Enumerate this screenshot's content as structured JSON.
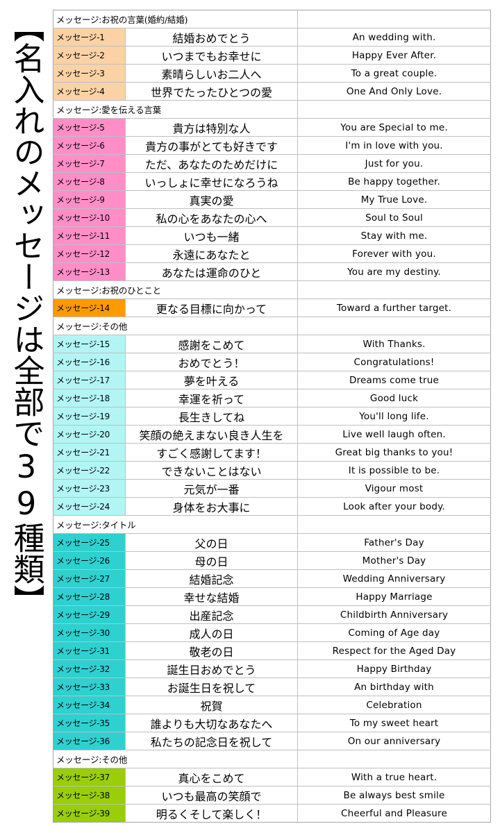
{
  "caption": {
    "vertical_text": "【名入れのメッセージは全部で39種類】"
  },
  "colors": {
    "group_peach": "#fbd2a6",
    "group_pink": "#ff8ec7",
    "group_orange": "#ff9900",
    "group_cyan": "#b3f5f5",
    "group_teal": "#2fd0d0",
    "group_olive": "#9acd0a",
    "table_border": "#a6a6a6",
    "grid_line": "#bfbfbf",
    "page_background": "#ffffff",
    "text": "#000000"
  },
  "table": {
    "columns": [
      "message_id",
      "japanese",
      "english"
    ],
    "rows": [
      {
        "kind": "group",
        "label": "メッセージ:お祝の言葉(婚約/結婚)",
        "color": null
      },
      {
        "kind": "item",
        "id": "メッセージ-1",
        "jp": "結婚おめでとう",
        "en": "An wedding with.",
        "color": "group_peach"
      },
      {
        "kind": "item",
        "id": "メッセージ-2",
        "jp": "いつまでもお幸せに",
        "en": "Happy Ever After.",
        "color": "group_peach"
      },
      {
        "kind": "item",
        "id": "メッセージ-3",
        "jp": "素晴らしいお二人へ",
        "en": "To a great couple.",
        "color": "group_peach"
      },
      {
        "kind": "item",
        "id": "メッセージ-4",
        "jp": "世界でたったひとつの愛",
        "en": "One And Only Love.",
        "color": "group_peach"
      },
      {
        "kind": "group",
        "label": "メッセージ:愛を伝える言葉",
        "color": null
      },
      {
        "kind": "item",
        "id": "メッセージ-5",
        "jp": "貴方は特別な人",
        "en": "You are Special to me.",
        "color": "group_pink"
      },
      {
        "kind": "item",
        "id": "メッセージ-6",
        "jp": "貴方の事がとても好きです",
        "en": "I'm in love with you.",
        "color": "group_pink"
      },
      {
        "kind": "item",
        "id": "メッセージ-7",
        "jp": "ただ、あなたのためだけに",
        "en": "Just for you.",
        "color": "group_pink"
      },
      {
        "kind": "item",
        "id": "メッセージ-8",
        "jp": "いっしょに幸せになろうね",
        "en": "Be happy together.",
        "color": "group_pink"
      },
      {
        "kind": "item",
        "id": "メッセージ-9",
        "jp": "真実の愛",
        "en": "My True Love.",
        "color": "group_pink"
      },
      {
        "kind": "item",
        "id": "メッセージ-10",
        "jp": "私の心をあなたの心へ",
        "en": "Soul to Soul",
        "color": "group_pink"
      },
      {
        "kind": "item",
        "id": "メッセージ-11",
        "jp": "いつも一緒",
        "en": "Stay with me.",
        "color": "group_pink"
      },
      {
        "kind": "item",
        "id": "メッセージ-12",
        "jp": "永遠にあなたと",
        "en": "Forever with you.",
        "color": "group_pink"
      },
      {
        "kind": "item",
        "id": "メッセージ-13",
        "jp": "あなたは運命のひと",
        "en": "You are my destiny.",
        "color": "group_pink"
      },
      {
        "kind": "group",
        "label": "メッセージ:お祝のひとこと",
        "color": null
      },
      {
        "kind": "item",
        "id": "メッセージ-14",
        "jp": "更なる目標に向かって",
        "en": "Toward a further target.",
        "color": "group_orange"
      },
      {
        "kind": "group",
        "label": "メッセージ:その他",
        "color": null
      },
      {
        "kind": "item",
        "id": "メッセージ-15",
        "jp": "感謝をこめて",
        "en": "With Thanks.",
        "color": "group_cyan"
      },
      {
        "kind": "item",
        "id": "メッセージ-16",
        "jp": "おめでとう！",
        "en": "Congratulations!",
        "color": "group_cyan"
      },
      {
        "kind": "item",
        "id": "メッセージ-17",
        "jp": "夢を叶える",
        "en": "Dreams come true",
        "color": "group_cyan"
      },
      {
        "kind": "item",
        "id": "メッセージ-18",
        "jp": "幸運を祈って",
        "en": "Good luck",
        "color": "group_cyan"
      },
      {
        "kind": "item",
        "id": "メッセージ-19",
        "jp": "長生きしてね",
        "en": "You'll long life.",
        "color": "group_cyan"
      },
      {
        "kind": "item",
        "id": "メッセージ-20",
        "jp": "笑顔の絶えまない良き人生を",
        "en": "Live well laugh often.",
        "color": "group_cyan"
      },
      {
        "kind": "item",
        "id": "メッセージ-21",
        "jp": "すごく感謝してます！",
        "en": "Great big thanks to you!",
        "color": "group_cyan"
      },
      {
        "kind": "item",
        "id": "メッセージ-22",
        "jp": "できないことはない",
        "en": "It is possible to be.",
        "color": "group_cyan"
      },
      {
        "kind": "item",
        "id": "メッセージ-23",
        "jp": "元気が一番",
        "en": "Vigour most",
        "color": "group_cyan"
      },
      {
        "kind": "item",
        "id": "メッセージ-24",
        "jp": "身体をお大事に",
        "en": "Look after your body.",
        "color": "group_cyan"
      },
      {
        "kind": "group",
        "label": "メッセージ:タイトル",
        "color": null
      },
      {
        "kind": "item",
        "id": "メッセージ-25",
        "jp": "父の日",
        "en": "Father's Day",
        "color": "group_teal"
      },
      {
        "kind": "item",
        "id": "メッセージ-26",
        "jp": "母の日",
        "en": "Mother's Day",
        "color": "group_teal"
      },
      {
        "kind": "item",
        "id": "メッセージ-27",
        "jp": "結婚記念",
        "en": "Wedding Anniversary",
        "color": "group_teal"
      },
      {
        "kind": "item",
        "id": "メッセージ-28",
        "jp": "幸せな結婚",
        "en": "Happy Marriage",
        "color": "group_teal"
      },
      {
        "kind": "item",
        "id": "メッセージ-29",
        "jp": "出産記念",
        "en": "Childbirth Anniversary",
        "color": "group_teal"
      },
      {
        "kind": "item",
        "id": "メッセージ-30",
        "jp": "成人の日",
        "en": "Coming of Age day",
        "color": "group_teal"
      },
      {
        "kind": "item",
        "id": "メッセージ-31",
        "jp": "敬老の日",
        "en": "Respect for the Aged Day",
        "color": "group_teal"
      },
      {
        "kind": "item",
        "id": "メッセージ-32",
        "jp": "誕生日おめでとう",
        "en": "Happy Birthday",
        "color": "group_teal"
      },
      {
        "kind": "item",
        "id": "メッセージ-33",
        "jp": "お誕生日を祝して",
        "en": "An birthday with",
        "color": "group_teal"
      },
      {
        "kind": "item",
        "id": "メッセージ-34",
        "jp": "祝賀",
        "en": "Celebration",
        "color": "group_teal"
      },
      {
        "kind": "item",
        "id": "メッセージ-35",
        "jp": "誰よりも大切なあなたへ",
        "en": "To my sweet heart",
        "color": "group_teal"
      },
      {
        "kind": "item",
        "id": "メッセージ-36",
        "jp": "私たちの記念日を祝して",
        "en": "On our anniversary",
        "color": "group_teal"
      },
      {
        "kind": "group",
        "label": "メッセージ:その他",
        "color": null
      },
      {
        "kind": "item",
        "id": "メッセージ-37",
        "jp": "真心をこめて",
        "en": "With a true heart.",
        "color": "group_olive"
      },
      {
        "kind": "item",
        "id": "メッセージ-38",
        "jp": "いつも最高の笑顔で",
        "en": "Be always best smile",
        "color": "group_olive"
      },
      {
        "kind": "item",
        "id": "メッセージ-39",
        "jp": "明るくそして楽しく！",
        "en": "Cheerful and Pleasure",
        "color": "group_olive"
      }
    ]
  }
}
